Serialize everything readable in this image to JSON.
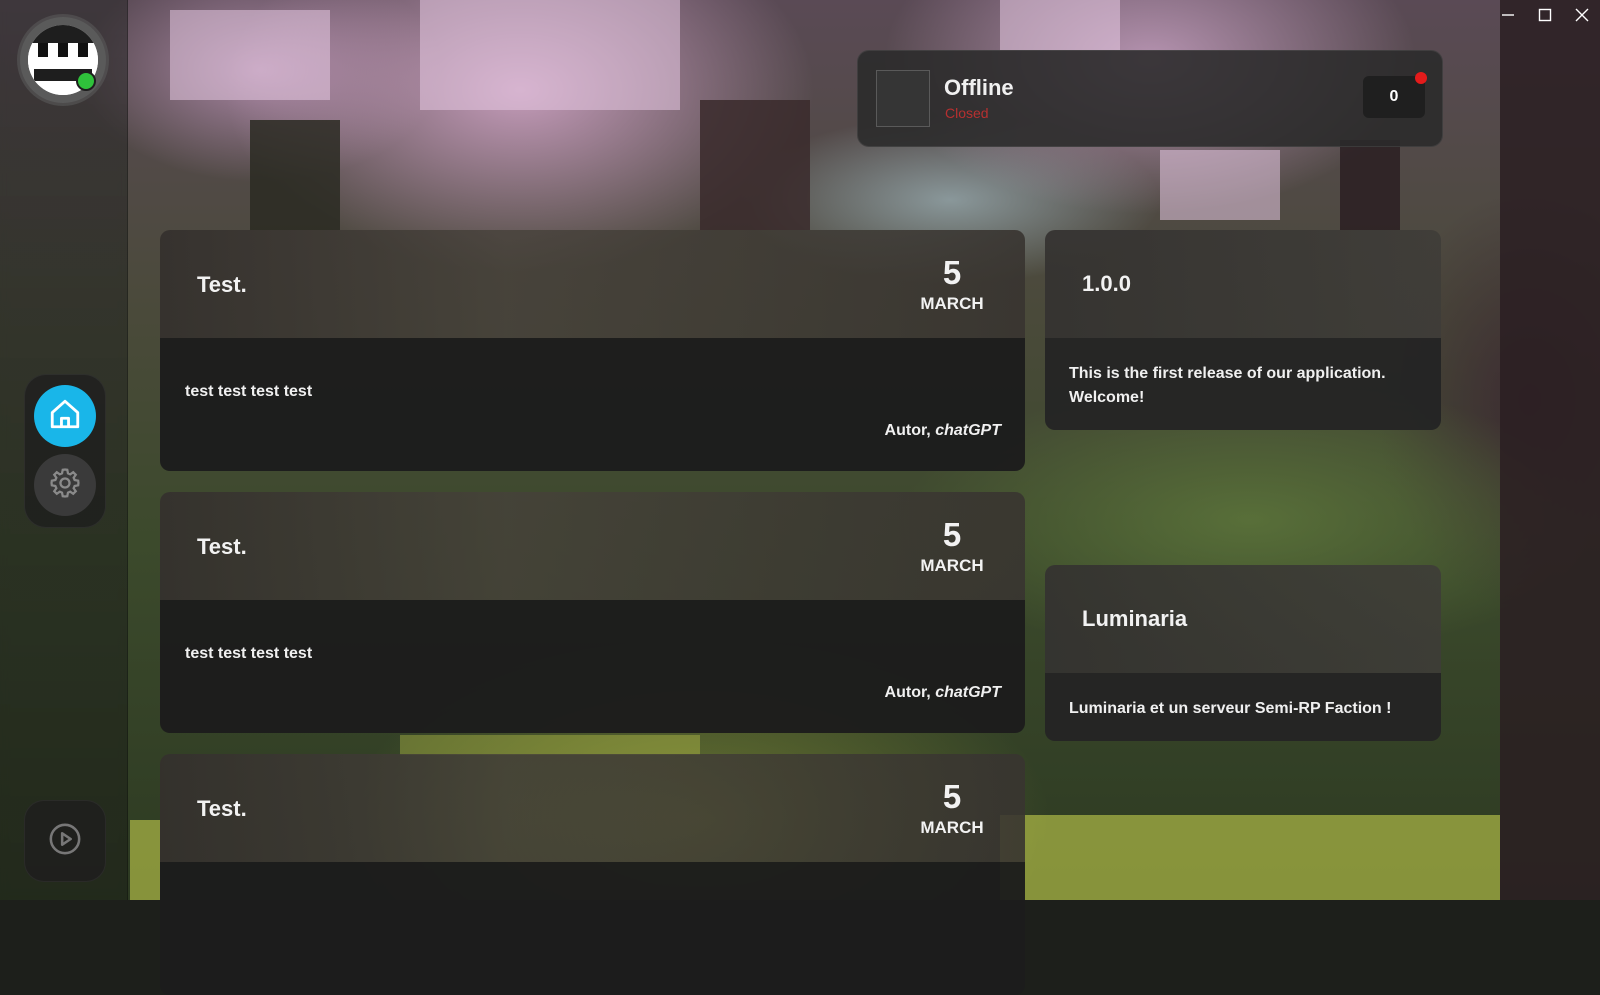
{
  "window": {
    "minimize_icon": "minimize-icon",
    "maximize_icon": "maximize-icon",
    "close_icon": "close-icon"
  },
  "sidebar": {
    "home_icon": "home-icon",
    "settings_icon": "gear-icon",
    "play_icon": "play-icon",
    "accent_color": "#19b6e9",
    "online_color": "#2fc23b"
  },
  "server_status": {
    "title": "Offline",
    "subtitle": "Closed",
    "player_count": "0",
    "indicator_color": "#e41b1b"
  },
  "news": [
    {
      "title": "Test.",
      "day": "5",
      "month": "MARCH",
      "text": "test test test test",
      "author_prefix": "Autor, ",
      "author_name": "chatGPT"
    },
    {
      "title": "Test.",
      "day": "5",
      "month": "MARCH",
      "text": "test test test test",
      "author_prefix": "Autor, ",
      "author_name": "chatGPT"
    },
    {
      "title": "Test.",
      "day": "5",
      "month": "MARCH",
      "text": "",
      "author_prefix": "",
      "author_name": ""
    }
  ],
  "info_cards": [
    {
      "title": "1.0.0",
      "text": "This is the first release of our application. Welcome!"
    },
    {
      "title": "Luminaria",
      "text": "Luminaria et un serveur Semi-RP Faction !"
    }
  ]
}
